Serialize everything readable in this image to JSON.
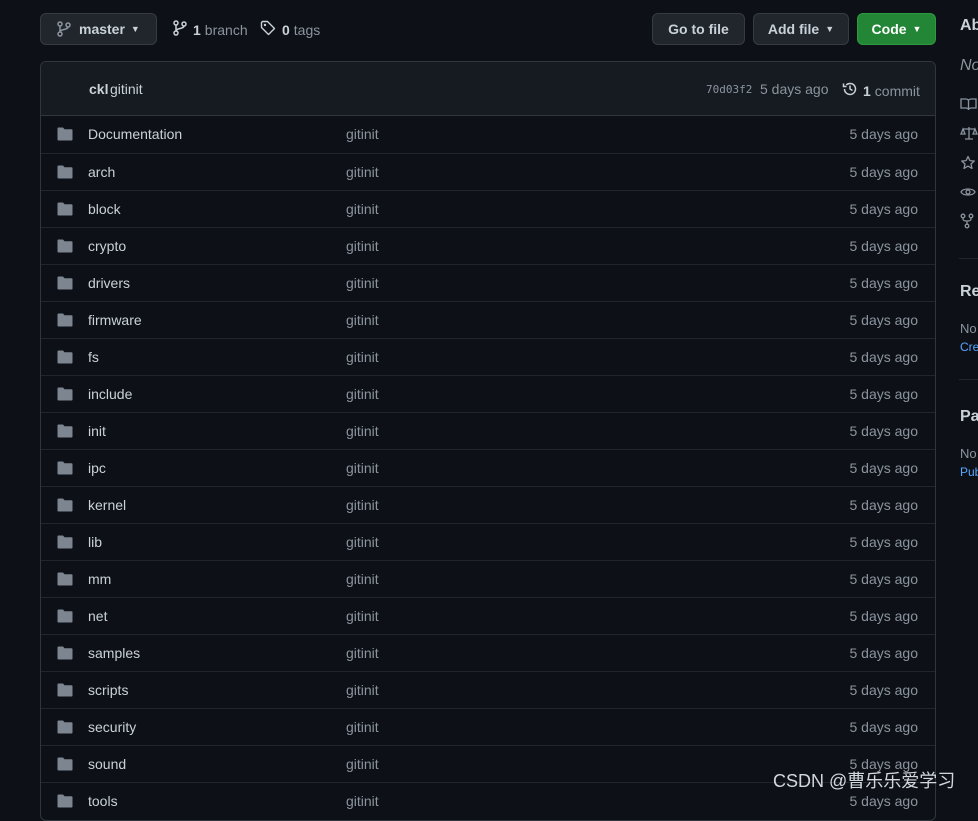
{
  "toolbar": {
    "branch_name": "master",
    "branches_count": "1",
    "branches_label": "branch",
    "tags_count": "0",
    "tags_label": "tags",
    "goto_label": "Go to file",
    "addfile_label": "Add file",
    "code_label": "Code"
  },
  "latest_commit": {
    "author": "ckl",
    "message": "gitinit",
    "sha": "70d03f2",
    "age": "5 days ago",
    "count": "1",
    "count_label": "commit"
  },
  "files": [
    {
      "name": "Documentation",
      "message": "gitinit",
      "age": "5 days ago"
    },
    {
      "name": "arch",
      "message": "gitinit",
      "age": "5 days ago"
    },
    {
      "name": "block",
      "message": "gitinit",
      "age": "5 days ago"
    },
    {
      "name": "crypto",
      "message": "gitinit",
      "age": "5 days ago"
    },
    {
      "name": "drivers",
      "message": "gitinit",
      "age": "5 days ago"
    },
    {
      "name": "firmware",
      "message": "gitinit",
      "age": "5 days ago"
    },
    {
      "name": "fs",
      "message": "gitinit",
      "age": "5 days ago"
    },
    {
      "name": "include",
      "message": "gitinit",
      "age": "5 days ago"
    },
    {
      "name": "init",
      "message": "gitinit",
      "age": "5 days ago"
    },
    {
      "name": "ipc",
      "message": "gitinit",
      "age": "5 days ago"
    },
    {
      "name": "kernel",
      "message": "gitinit",
      "age": "5 days ago"
    },
    {
      "name": "lib",
      "message": "gitinit",
      "age": "5 days ago"
    },
    {
      "name": "mm",
      "message": "gitinit",
      "age": "5 days ago"
    },
    {
      "name": "net",
      "message": "gitinit",
      "age": "5 days ago"
    },
    {
      "name": "samples",
      "message": "gitinit",
      "age": "5 days ago"
    },
    {
      "name": "scripts",
      "message": "gitinit",
      "age": "5 days ago"
    },
    {
      "name": "security",
      "message": "gitinit",
      "age": "5 days ago"
    },
    {
      "name": "sound",
      "message": "gitinit",
      "age": "5 days ago"
    },
    {
      "name": "tools",
      "message": "gitinit",
      "age": "5 days ago"
    }
  ],
  "sidebar": {
    "about_heading": "Ab",
    "about_desc": "No",
    "releases_heading": "Re",
    "releases_text": "No",
    "releases_link": "Cre",
    "packages_heading": "Pa",
    "packages_text": "No",
    "packages_link": "Pub"
  },
  "watermark": "CSDN @曹乐乐爱学习",
  "colors": {
    "background": "#0d1117",
    "header_bg": "#161b22",
    "border": "#30363d",
    "code_button": "#238636",
    "folder_icon": "#7d8590",
    "link": "#58a6ff"
  }
}
